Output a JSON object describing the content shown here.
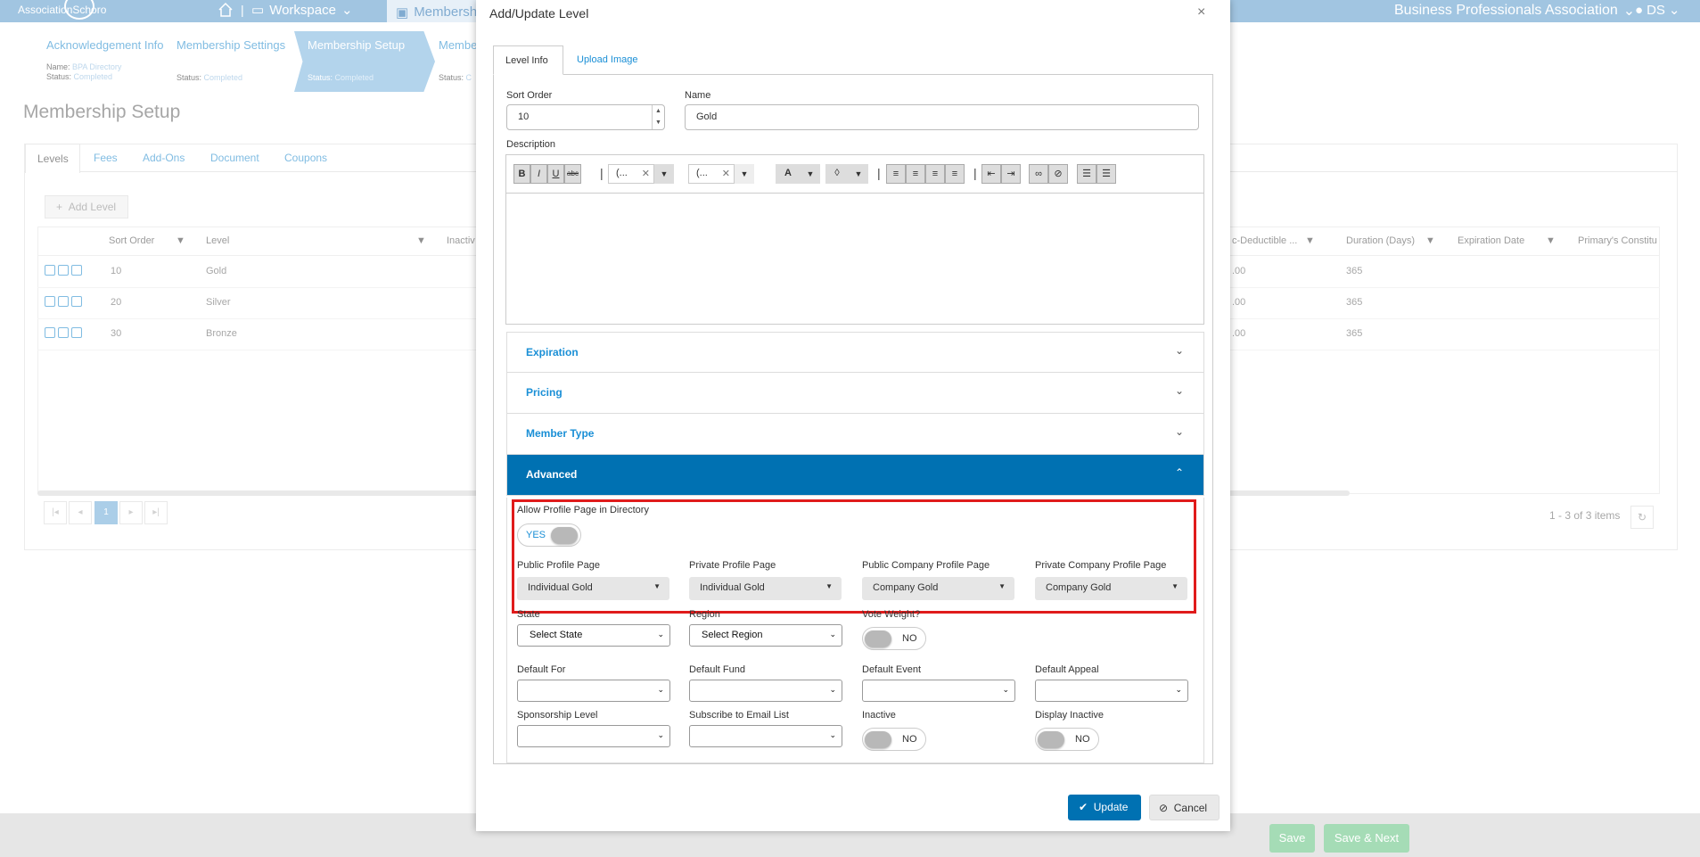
{
  "topbar": {
    "logo": "AssociationSchoro",
    "workspace": "Workspace",
    "membership_tab": "Membersh",
    "org": "Business Professionals Association",
    "user": "DS"
  },
  "wizard": {
    "steps": [
      {
        "title": "Acknowledgement Info",
        "name_label": "Name:",
        "name_value": "BPA Directory",
        "status_label": "Status:",
        "status_value": "Completed"
      },
      {
        "title": "Membership Settings",
        "status_label": "Status:",
        "status_value": "Completed"
      },
      {
        "title": "Membership Setup",
        "status_label": "Status:",
        "status_value": "Completed"
      },
      {
        "title": "Membe",
        "status_label": "Status:",
        "status_value": "C"
      }
    ]
  },
  "page_title": "Membership Setup",
  "bg_tabs": [
    "Levels",
    "Fees",
    "Add-Ons",
    "Document",
    "Coupons"
  ],
  "add_level": "Add Level",
  "grid": {
    "headers_left": [
      "Sort Order",
      "Level",
      "Inactiv"
    ],
    "headers_right": [
      "c-Deductible ...",
      "Duration (Days)",
      "Expiration Date",
      "Primary's Constitu"
    ],
    "rows": [
      {
        "sort": "10",
        "level": "Gold",
        "ded": ".00",
        "dur": "365"
      },
      {
        "sort": "20",
        "level": "Silver",
        "ded": ".00",
        "dur": "365"
      },
      {
        "sort": "30",
        "level": "Bronze",
        "ded": ".00",
        "dur": "365"
      }
    ],
    "page": "1",
    "items": "1 - 3 of 3 items"
  },
  "footer": {
    "save": "Save",
    "save_next": "Save & Next"
  },
  "modal": {
    "title": "Add/Update Level",
    "close": "×",
    "tabs": [
      "Level Info",
      "Upload Image"
    ],
    "sort_order_label": "Sort Order",
    "sort_order_value": "10",
    "name_label": "Name",
    "name_value": "Gold",
    "description_label": "Description",
    "toolbar": {
      "bold": "B",
      "italic": "I",
      "underline": "U",
      "strike": "abc",
      "font": "(...",
      "size": "(...",
      "color": "A"
    },
    "accordions": [
      "Expiration",
      "Pricing",
      "Member Type",
      "Advanced"
    ],
    "advanced": {
      "allow_profile_label": "Allow Profile Page in Directory",
      "allow_profile_value": "YES",
      "public_profile_label": "Public Profile Page",
      "public_profile_value": "Individual Gold",
      "private_profile_label": "Private Profile Page",
      "private_profile_value": "Individual Gold",
      "public_company_label": "Public Company Profile Page",
      "public_company_value": "Company Gold",
      "private_company_label": "Private Company Profile Page",
      "private_company_value": "Company Gold",
      "state_label": "State",
      "state_value": "Select State",
      "region_label": "Region",
      "region_value": "Select Region",
      "vote_label": "Vote Weight?",
      "vote_value": "NO",
      "default_for_label": "Default For",
      "default_fund_label": "Default Fund",
      "default_event_label": "Default Event",
      "default_appeal_label": "Default Appeal",
      "sponsorship_label": "Sponsorship Level",
      "email_list_label": "Subscribe to Email List",
      "inactive_label": "Inactive",
      "inactive_value": "NO",
      "display_inactive_label": "Display Inactive",
      "display_inactive_value": "NO"
    },
    "update": "Update",
    "cancel": "Cancel"
  },
  "colors": {
    "accent": "#0071b2",
    "link": "#1a8fd6",
    "highlight": "#e01b1b",
    "topbar": "#6fa7d2"
  }
}
